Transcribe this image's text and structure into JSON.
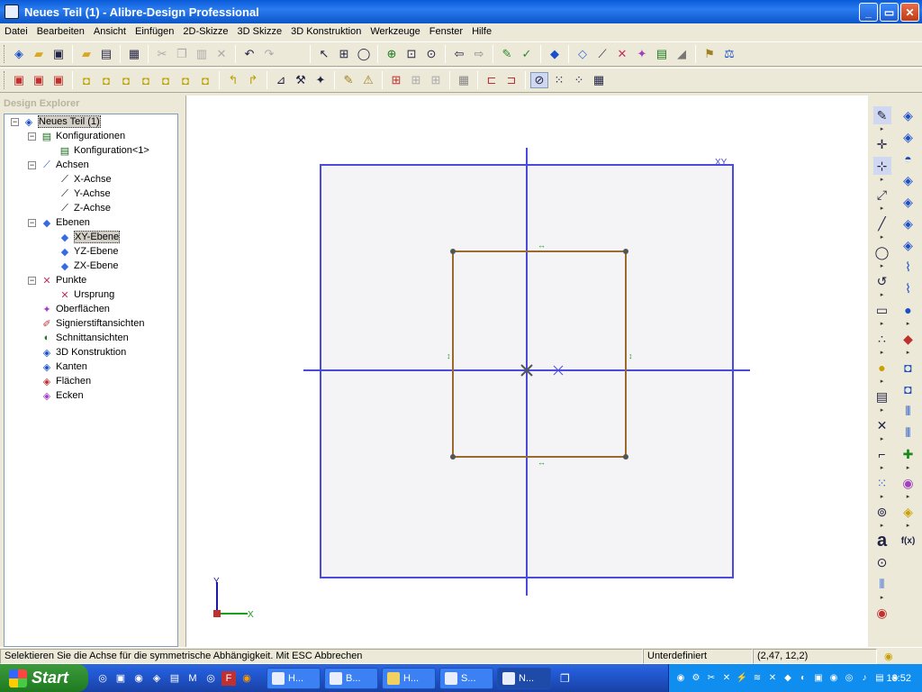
{
  "window": {
    "title": "Neues Teil (1) - Alibre-Design Professional",
    "min": "_",
    "max": "▭",
    "close": "✕"
  },
  "menu": [
    "Datei",
    "Bearbeiten",
    "Ansicht",
    "Einfügen",
    "2D-Skizze",
    "3D Skizze",
    "3D Konstruktion",
    "Werkzeuge",
    "Fenster",
    "Hilfe"
  ],
  "explorer": {
    "title": "Design Explorer",
    "root": "Neues Teil (1)",
    "konfigurationen": "Konfigurationen",
    "konfiguration": "Konfiguration<1>",
    "achsen": "Achsen",
    "x_achse": "X-Achse",
    "y_achse": "Y-Achse",
    "z_achse": "Z-Achse",
    "ebenen": "Ebenen",
    "xy": "XY-Ebene",
    "yz": "YZ-Ebene",
    "zx": "ZX-Ebene",
    "punkte": "Punkte",
    "ursprung": "Ursprung",
    "oberflaechen": "Oberflächen",
    "signier": "Signierstiftansichten",
    "schnitt": "Schnittansichten",
    "konstruktion": "3D Konstruktion",
    "kanten": "Kanten",
    "flaechen": "Flächen",
    "ecken": "Ecken"
  },
  "canvas": {
    "plane_label": "XY",
    "axis_y": "Y",
    "axis_x": "X"
  },
  "status": {
    "message": "Selektieren Sie die Achse für die symmetrische Abhängigkeit. Mit ESC Abbrechen",
    "state": "Unterdefiniert",
    "coords": "(2,47, 12,2)"
  },
  "taskbar": {
    "start": "Start",
    "tasks": [
      "H...",
      "B...",
      "H...",
      "S...",
      "N..."
    ],
    "clock": "18:52"
  },
  "colors": {
    "plane_fill": "#f4f4f7",
    "plane_border": "#4a4adc",
    "sketch": "#9b6a2e",
    "constraint": "#1aa01a"
  }
}
